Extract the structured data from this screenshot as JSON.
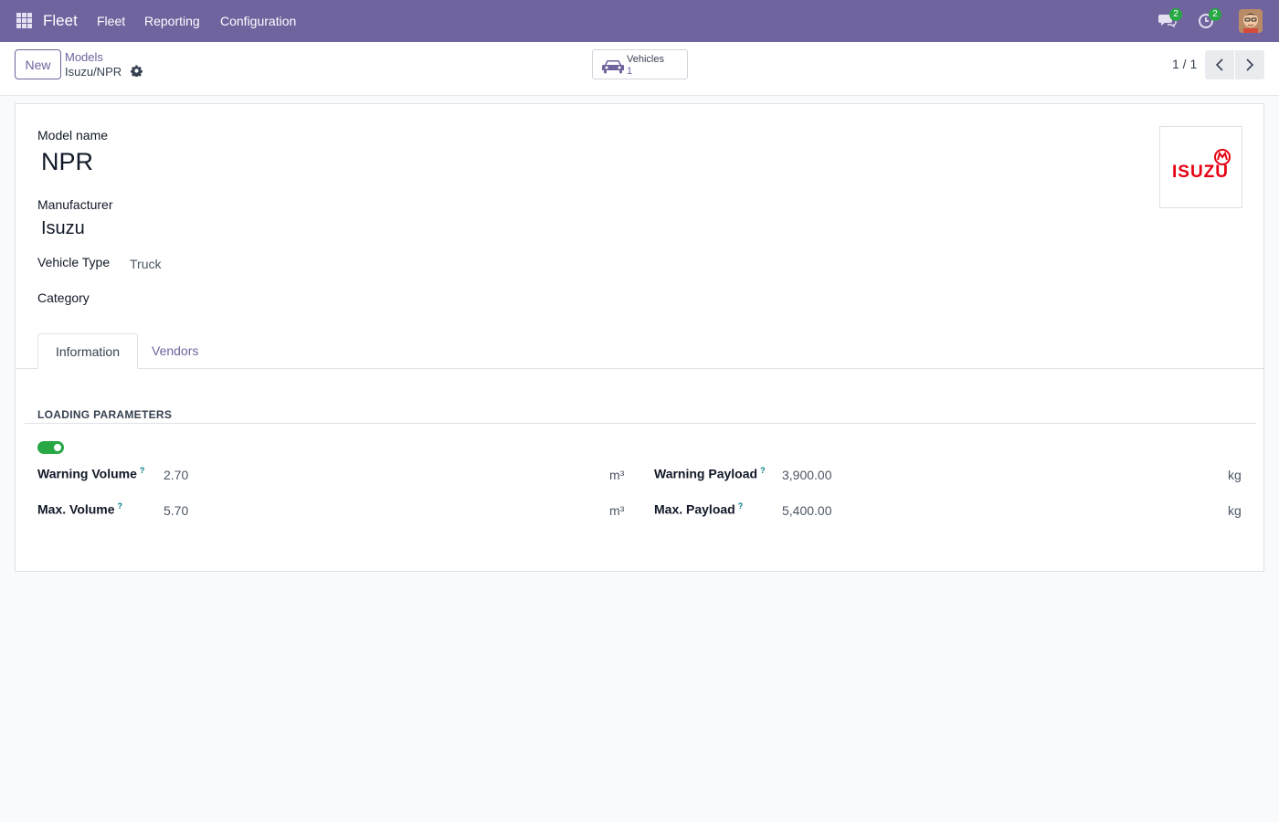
{
  "navbar": {
    "app_name": "Fleet",
    "menu": [
      "Fleet",
      "Reporting",
      "Configuration"
    ],
    "messages_badge": "2",
    "activities_badge": "2",
    "accent_color": "#71639e",
    "icons": [
      "apps-grid-icon",
      "chat-icon",
      "clock-icon",
      "user-avatar"
    ]
  },
  "control_panel": {
    "new_label": "New",
    "breadcrumb_parent": "Models",
    "breadcrumb_current": "Isuzu/NPR",
    "smart_button": {
      "label": "Vehicles",
      "value": "1",
      "icon": "car-icon"
    },
    "pager": "1 / 1"
  },
  "form": {
    "model_name_label": "Model name",
    "model_name_value": "NPR",
    "manufacturer_label": "Manufacturer",
    "manufacturer_value": "Isuzu",
    "vehicle_type_label": "Vehicle Type",
    "vehicle_type_value": "Truck",
    "category_label": "Category",
    "logo": {
      "text": "ISUZU",
      "color": "#e60012"
    },
    "tabs": [
      "Information",
      "Vendors"
    ],
    "section_title": "LOADING PARAMETERS",
    "toggle_on": true,
    "fields": {
      "warning_volume": {
        "label": "Warning Volume",
        "help": "?",
        "value": "2.70",
        "unit": "m³"
      },
      "max_volume": {
        "label": "Max. Volume",
        "help": "?",
        "value": "5.70",
        "unit": "m³"
      },
      "warning_payload": {
        "label": "Warning Payload",
        "help": "?",
        "value": "3,900.00",
        "unit": "kg"
      },
      "max_payload": {
        "label": "Max. Payload",
        "help": "?",
        "value": "5,400.00",
        "unit": "kg"
      }
    }
  }
}
